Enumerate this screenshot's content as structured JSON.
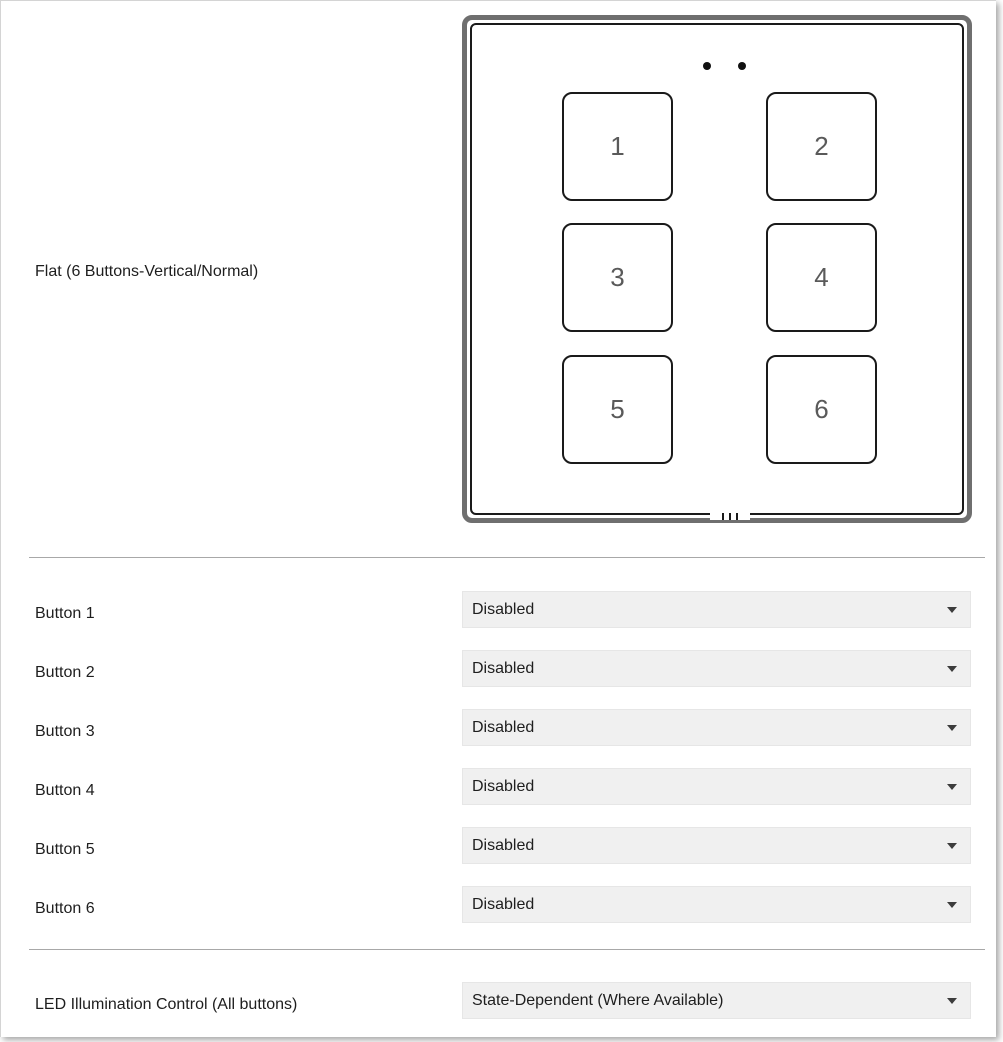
{
  "device": {
    "model_label": "Flat (6 Buttons-Vertical/Normal)",
    "keys": [
      "1",
      "2",
      "3",
      "4",
      "5",
      "6"
    ]
  },
  "buttons": [
    {
      "label": "Button 1",
      "value": "Disabled"
    },
    {
      "label": "Button 2",
      "value": "Disabled"
    },
    {
      "label": "Button 3",
      "value": "Disabled"
    },
    {
      "label": "Button 4",
      "value": "Disabled"
    },
    {
      "label": "Button 5",
      "value": "Disabled"
    },
    {
      "label": "Button 6",
      "value": "Disabled"
    }
  ],
  "led": {
    "label": "LED Illumination Control (All buttons)",
    "value": "State-Dependent (Where Available)"
  },
  "icons": {
    "dropdown": "chevron-down-icon"
  },
  "colors": {
    "select_bg": "#f0f0f0",
    "divider": "#a8a8a8",
    "panel_frame": "#6f6f6f"
  }
}
